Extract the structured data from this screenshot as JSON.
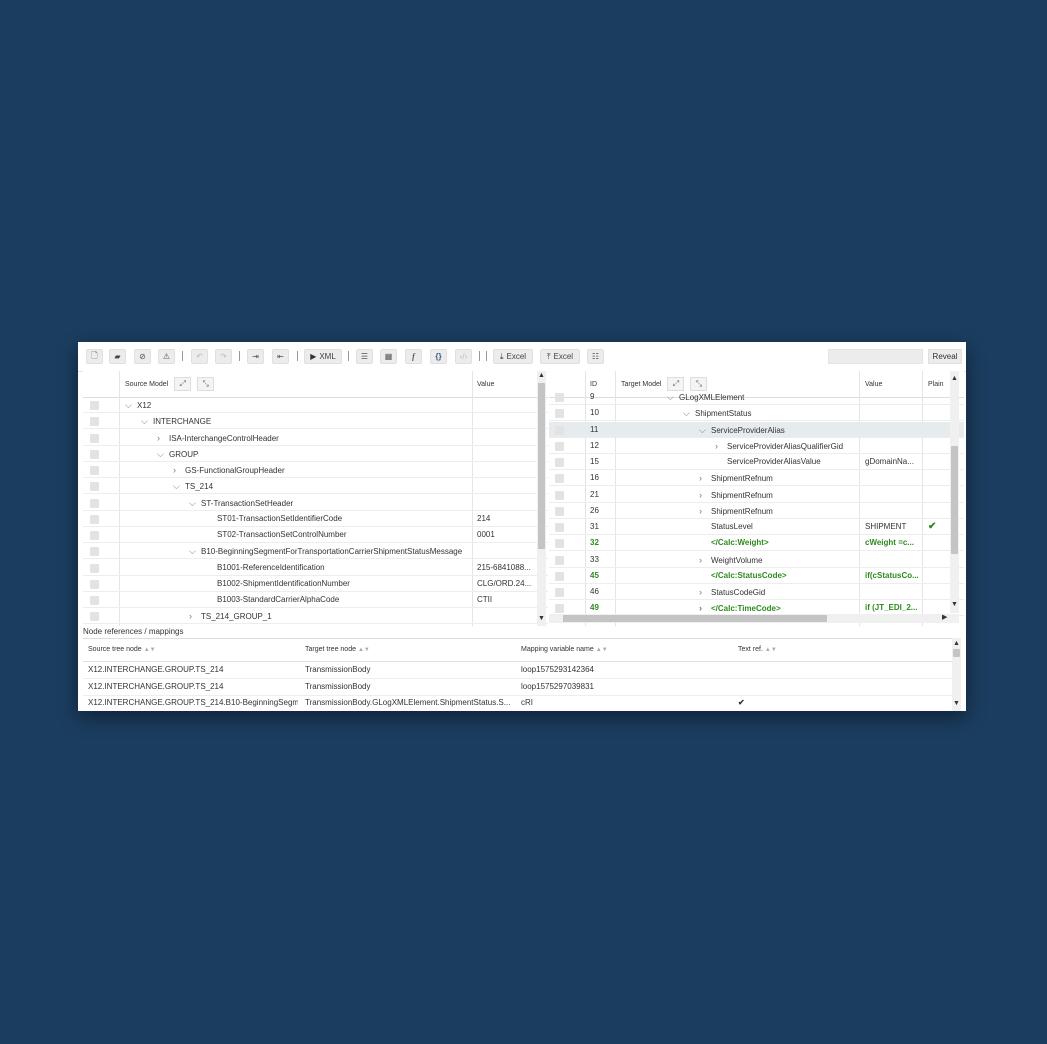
{
  "toolbar": {
    "xml_label": "XML",
    "excel_import_label": "Excel",
    "excel_export_label": "Excel",
    "reveal_label": "Reveal"
  },
  "source": {
    "header": {
      "model": "Source Model",
      "value": "Value"
    },
    "rows": [
      {
        "label": "X12",
        "value": "",
        "depth": 0,
        "expander": "open"
      },
      {
        "label": "INTERCHANGE",
        "value": "",
        "depth": 1,
        "expander": "open"
      },
      {
        "label": "ISA-InterchangeControlHeader",
        "value": "",
        "depth": 2,
        "expander": "closed"
      },
      {
        "label": "GROUP",
        "value": "",
        "depth": 2,
        "expander": "open"
      },
      {
        "label": "GS-FunctionalGroupHeader",
        "value": "",
        "depth": 3,
        "expander": "closed"
      },
      {
        "label": "TS_214",
        "value": "",
        "depth": 3,
        "expander": "open"
      },
      {
        "label": "ST-TransactionSetHeader",
        "value": "",
        "depth": 4,
        "expander": "open"
      },
      {
        "label": "ST01-TransactionSetIdentifierCode",
        "value": "214",
        "depth": 5,
        "expander": "none"
      },
      {
        "label": "ST02-TransactionSetControlNumber",
        "value": "0001",
        "depth": 5,
        "expander": "none"
      },
      {
        "label": "B10-BeginningSegmentForTransportationCarrierShipmentStatusMessage",
        "value": "",
        "depth": 4,
        "expander": "open"
      },
      {
        "label": "B1001-ReferenceIdentification",
        "value": "215-6841088...",
        "depth": 5,
        "expander": "none"
      },
      {
        "label": "B1002-ShipmentIdentificationNumber",
        "value": "CLG/ORD.24...",
        "depth": 5,
        "expander": "none"
      },
      {
        "label": "B1003-StandardCarrierAlphaCode",
        "value": "CTII",
        "depth": 5,
        "expander": "none"
      },
      {
        "label": "TS_214_GROUP_1",
        "value": "",
        "depth": 4,
        "expander": "closed"
      }
    ]
  },
  "target": {
    "header": {
      "id": "ID",
      "model": "Target Model",
      "value": "Value",
      "plain": "Plain"
    },
    "rows": [
      {
        "id": "9",
        "label": "GLogXMLElement",
        "value": "",
        "depth": 0,
        "expander": "open",
        "green": false,
        "plain": false,
        "selected": false
      },
      {
        "id": "10",
        "label": "ShipmentStatus",
        "value": "",
        "depth": 1,
        "expander": "open",
        "green": false,
        "plain": false,
        "selected": false
      },
      {
        "id": "11",
        "label": "ServiceProviderAlias",
        "value": "",
        "depth": 2,
        "expander": "open",
        "green": false,
        "plain": false,
        "selected": true
      },
      {
        "id": "12",
        "label": "ServiceProviderAliasQualifierGid",
        "value": "",
        "depth": 3,
        "expander": "closed",
        "green": false,
        "plain": false,
        "selected": false
      },
      {
        "id": "15",
        "label": "ServiceProviderAliasValue",
        "value": "gDomainNa...",
        "depth": 3,
        "expander": "none",
        "green": false,
        "plain": false,
        "selected": false
      },
      {
        "id": "16",
        "label": "ShipmentRefnum",
        "value": "",
        "depth": 2,
        "expander": "closed",
        "green": false,
        "plain": false,
        "selected": false
      },
      {
        "id": "21",
        "label": "ShipmentRefnum",
        "value": "",
        "depth": 2,
        "expander": "closed",
        "green": false,
        "plain": false,
        "selected": false
      },
      {
        "id": "26",
        "label": "ShipmentRefnum",
        "value": "",
        "depth": 2,
        "expander": "closed",
        "green": false,
        "plain": false,
        "selected": false
      },
      {
        "id": "31",
        "label": "StatusLevel",
        "value": "SHIPMENT",
        "depth": 2,
        "expander": "none",
        "green": false,
        "plain": true,
        "selected": false
      },
      {
        "id": "32",
        "label": "</Calc:Weight>",
        "value": "cWeight =c...",
        "depth": 2,
        "expander": "none",
        "green": true,
        "plain": false,
        "selected": false
      },
      {
        "id": "33",
        "label": "WeightVolume",
        "value": "",
        "depth": 2,
        "expander": "closed",
        "green": false,
        "plain": false,
        "selected": false
      },
      {
        "id": "45",
        "label": "</Calc:StatusCode>",
        "value": "if(cStatusCo...",
        "depth": 2,
        "expander": "none",
        "green": true,
        "plain": false,
        "selected": false
      },
      {
        "id": "46",
        "label": "StatusCodeGid",
        "value": "",
        "depth": 2,
        "expander": "closed",
        "green": false,
        "plain": false,
        "selected": false
      },
      {
        "id": "49",
        "label": "</Calc:TimeCode>",
        "value": "if (JT_EDI_2...",
        "depth": 2,
        "expander": "closed",
        "green": true,
        "plain": false,
        "selected": false
      }
    ]
  },
  "refs": {
    "title": "Node references / mappings",
    "columns": [
      "Source tree node",
      "Target tree node",
      "Mapping variable name",
      "Text ref."
    ],
    "rows": [
      {
        "source": "X12.INTERCHANGE.GROUP.TS_214",
        "target": "TransmissionBody",
        "variable": "loop1575293142364",
        "textref": false
      },
      {
        "source": "X12.INTERCHANGE.GROUP.TS_214",
        "target": "TransmissionBody",
        "variable": "loop1575297039831",
        "textref": false
      },
      {
        "source": "X12.INTERCHANGE.GROUP.TS_214.B10-BeginningSegm...",
        "target": "TransmissionBody.GLogXMLElement.ShipmentStatus.S...",
        "variable": "cRI",
        "textref": true
      }
    ]
  }
}
